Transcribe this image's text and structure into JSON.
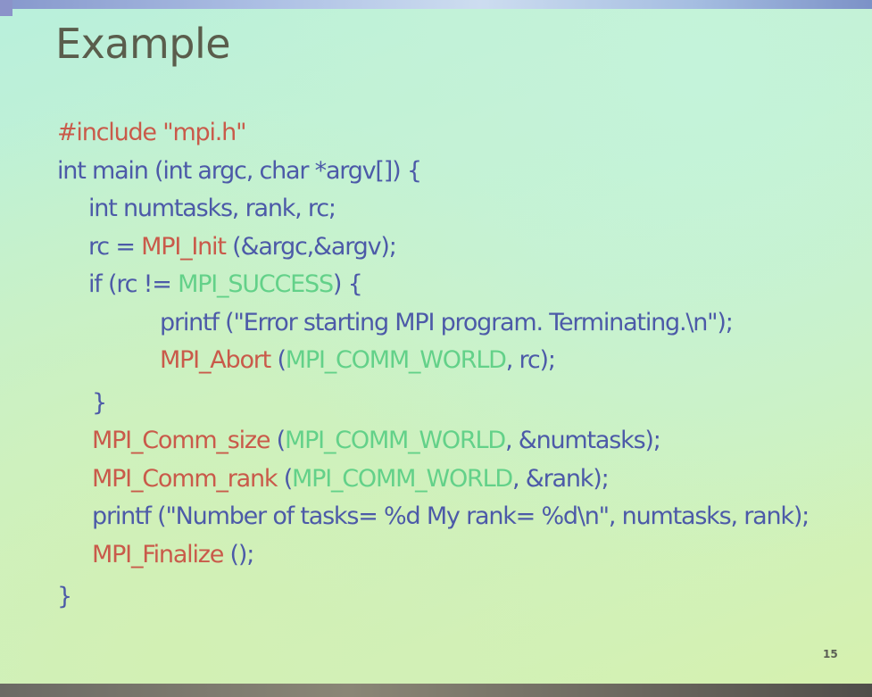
{
  "slide": {
    "title": "Example",
    "page_number": "15"
  },
  "code": {
    "l1": {
      "a": "#include \"mpi.h\""
    },
    "l2": {
      "a": "int main (int argc, char *argv[]) {"
    },
    "l3": {
      "a": "int numtasks, rank, rc;"
    },
    "l4": {
      "a": "rc = ",
      "b": "MPI_Init",
      "c": " (&argc,&argv);"
    },
    "l5": {
      "a": "if (rc != ",
      "b": "MPI_SUCCESS",
      "c": ") {"
    },
    "l6": {
      "a": "printf (\"Error starting MPI program. Terminating.\\n\");"
    },
    "l7": {
      "a": "MPI_Abort",
      "b": " (",
      "c": "MPI_COMM_WORLD",
      "d": ", rc);"
    },
    "l8": {
      "a": "}"
    },
    "l9": {
      "a": "MPI_Comm_size",
      "b": " (",
      "c": "MPI_COMM_WORLD",
      "d": ", &numtasks);"
    },
    "l10": {
      "a": "MPI_Comm_rank",
      "b": " (",
      "c": "MPI_COMM_WORLD",
      "d": ", &rank);"
    },
    "l11": {
      "a": "printf (\"Number of tasks= %d My rank= %d\\n\", numtasks, rank);"
    },
    "l12": {
      "a": "MPI_Finalize",
      "b": " ();"
    },
    "l13": {
      "a": "}"
    }
  },
  "colors": {
    "keyword_red": "#c95a4a",
    "code_blue": "#4c5aa8",
    "constant_green": "#63d189",
    "title_gray": "#5a5d4c"
  }
}
